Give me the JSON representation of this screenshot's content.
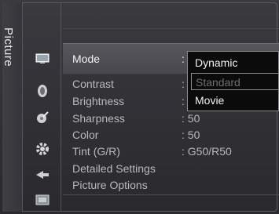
{
  "side_tab": {
    "label": "Picture"
  },
  "icons": [
    {
      "name": "picture-icon"
    },
    {
      "name": "sound-icon"
    },
    {
      "name": "channel-icon"
    },
    {
      "name": "setup-icon"
    },
    {
      "name": "input-icon"
    },
    {
      "name": "application-icon"
    }
  ],
  "menu": {
    "mode": {
      "label": "Mode",
      "value": ":"
    },
    "contrast": {
      "label": "Contrast",
      "value": ":"
    },
    "brightness": {
      "label": "Brightness",
      "value": ":"
    },
    "sharpness": {
      "label": "Sharpness",
      "value": ": 50"
    },
    "color": {
      "label": "Color",
      "value": ": 50"
    },
    "tint": {
      "label": "Tint (G/R)",
      "value": ": G50/R50"
    },
    "detailed_settings": {
      "label": "Detailed Settings"
    },
    "picture_options": {
      "label": "Picture Options"
    }
  },
  "dropdown": {
    "options": [
      {
        "label": "Dynamic",
        "state": "selected"
      },
      {
        "label": "Standard",
        "state": "disabled"
      },
      {
        "label": "Movie",
        "state": "normal"
      }
    ]
  }
}
